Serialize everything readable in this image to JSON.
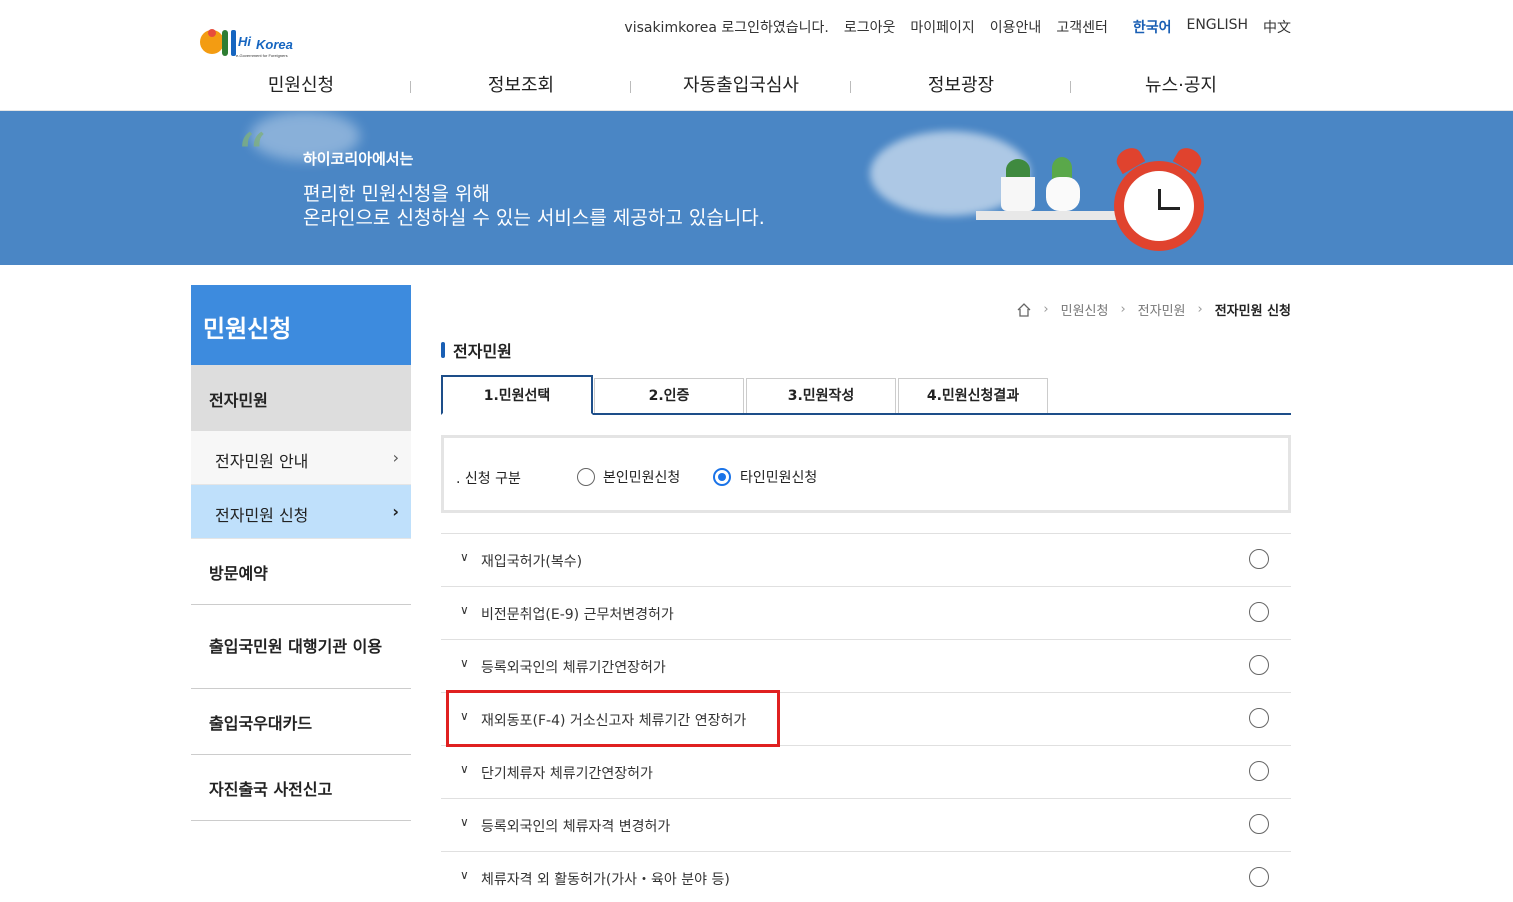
{
  "header": {
    "logo_text": "Hi Korea",
    "logo_sub": "e-Government for Foreigners",
    "util_links": [
      "visakimkorea 로그인하였습니다.",
      "로그아웃",
      "마이페이지",
      "이용안내",
      "고객센터"
    ],
    "languages": [
      "한국어",
      "ENGLISH",
      "中文"
    ],
    "active_language": "한국어",
    "nav": [
      "민원신청",
      "정보조회",
      "자동출입국심사",
      "정보광장",
      "뉴스·공지"
    ]
  },
  "banner": {
    "line1": "하이코리아에서는",
    "line2": "편리한 민원신청을 위해",
    "line3": "온라인으로 신청하실 수 있는 서비스를 제공하고 있습니다."
  },
  "sidebar": {
    "title": "민원신청",
    "current": "전자민원",
    "sub_items": [
      {
        "label": "전자민원 안내",
        "active": false
      },
      {
        "label": "전자민원 신청",
        "active": true
      }
    ],
    "menu": [
      "방문예약",
      "출입국민원 대행기관 이용",
      "출입국우대카드",
      "자진출국 사전신고"
    ]
  },
  "breadcrumb": [
    "민원신청",
    "전자민원",
    "전자민원 신청"
  ],
  "section_title": "전자민원",
  "tabs": [
    "1.민원선택",
    "2.인증",
    "3.민원작성",
    "4.민원신청결과"
  ],
  "active_tab": 0,
  "apply_type": {
    "label": "신청 구분",
    "options": [
      "본인민원신청",
      "타인민원신청"
    ],
    "selected": "타인민원신청"
  },
  "civil_list": [
    "재입국허가(복수)",
    "비전문취업(E-9) 근무처변경허가",
    "등록외국인의 체류기간연장허가",
    "재외동포(F-4) 거소신고자 체류기간 연장허가",
    "단기체류자 체류기간연장허가",
    "등록외국인의 체류자격 변경허가",
    "체류자격 외 활동허가(가사・육아 분야 등)"
  ],
  "highlighted_item": "재외동포(F-4) 거소신고자 체류기간 연장허가",
  "colors": {
    "accent": "#3d8bde",
    "banner": "#4a86c5",
    "highlight": "#e02020",
    "tab_border": "#1d4e89"
  }
}
